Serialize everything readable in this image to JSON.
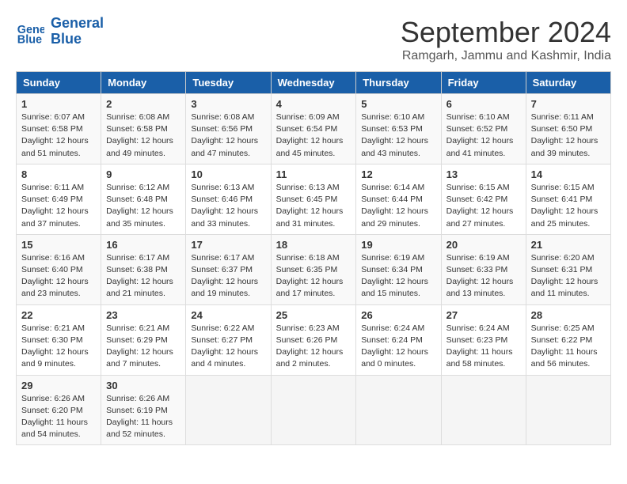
{
  "header": {
    "logo_line1": "General",
    "logo_line2": "Blue",
    "title": "September 2024",
    "location": "Ramgarh, Jammu and Kashmir, India"
  },
  "columns": [
    "Sunday",
    "Monday",
    "Tuesday",
    "Wednesday",
    "Thursday",
    "Friday",
    "Saturday"
  ],
  "weeks": [
    [
      {
        "day": "1",
        "sunrise": "Sunrise: 6:07 AM",
        "sunset": "Sunset: 6:58 PM",
        "daylight": "Daylight: 12 hours and 51 minutes."
      },
      {
        "day": "2",
        "sunrise": "Sunrise: 6:08 AM",
        "sunset": "Sunset: 6:58 PM",
        "daylight": "Daylight: 12 hours and 49 minutes."
      },
      {
        "day": "3",
        "sunrise": "Sunrise: 6:08 AM",
        "sunset": "Sunset: 6:56 PM",
        "daylight": "Daylight: 12 hours and 47 minutes."
      },
      {
        "day": "4",
        "sunrise": "Sunrise: 6:09 AM",
        "sunset": "Sunset: 6:54 PM",
        "daylight": "Daylight: 12 hours and 45 minutes."
      },
      {
        "day": "5",
        "sunrise": "Sunrise: 6:10 AM",
        "sunset": "Sunset: 6:53 PM",
        "daylight": "Daylight: 12 hours and 43 minutes."
      },
      {
        "day": "6",
        "sunrise": "Sunrise: 6:10 AM",
        "sunset": "Sunset: 6:52 PM",
        "daylight": "Daylight: 12 hours and 41 minutes."
      },
      {
        "day": "7",
        "sunrise": "Sunrise: 6:11 AM",
        "sunset": "Sunset: 6:50 PM",
        "daylight": "Daylight: 12 hours and 39 minutes."
      }
    ],
    [
      {
        "day": "8",
        "sunrise": "Sunrise: 6:11 AM",
        "sunset": "Sunset: 6:49 PM",
        "daylight": "Daylight: 12 hours and 37 minutes."
      },
      {
        "day": "9",
        "sunrise": "Sunrise: 6:12 AM",
        "sunset": "Sunset: 6:48 PM",
        "daylight": "Daylight: 12 hours and 35 minutes."
      },
      {
        "day": "10",
        "sunrise": "Sunrise: 6:13 AM",
        "sunset": "Sunset: 6:46 PM",
        "daylight": "Daylight: 12 hours and 33 minutes."
      },
      {
        "day": "11",
        "sunrise": "Sunrise: 6:13 AM",
        "sunset": "Sunset: 6:45 PM",
        "daylight": "Daylight: 12 hours and 31 minutes."
      },
      {
        "day": "12",
        "sunrise": "Sunrise: 6:14 AM",
        "sunset": "Sunset: 6:44 PM",
        "daylight": "Daylight: 12 hours and 29 minutes."
      },
      {
        "day": "13",
        "sunrise": "Sunrise: 6:15 AM",
        "sunset": "Sunset: 6:42 PM",
        "daylight": "Daylight: 12 hours and 27 minutes."
      },
      {
        "day": "14",
        "sunrise": "Sunrise: 6:15 AM",
        "sunset": "Sunset: 6:41 PM",
        "daylight": "Daylight: 12 hours and 25 minutes."
      }
    ],
    [
      {
        "day": "15",
        "sunrise": "Sunrise: 6:16 AM",
        "sunset": "Sunset: 6:40 PM",
        "daylight": "Daylight: 12 hours and 23 minutes."
      },
      {
        "day": "16",
        "sunrise": "Sunrise: 6:17 AM",
        "sunset": "Sunset: 6:38 PM",
        "daylight": "Daylight: 12 hours and 21 minutes."
      },
      {
        "day": "17",
        "sunrise": "Sunrise: 6:17 AM",
        "sunset": "Sunset: 6:37 PM",
        "daylight": "Daylight: 12 hours and 19 minutes."
      },
      {
        "day": "18",
        "sunrise": "Sunrise: 6:18 AM",
        "sunset": "Sunset: 6:35 PM",
        "daylight": "Daylight: 12 hours and 17 minutes."
      },
      {
        "day": "19",
        "sunrise": "Sunrise: 6:19 AM",
        "sunset": "Sunset: 6:34 PM",
        "daylight": "Daylight: 12 hours and 15 minutes."
      },
      {
        "day": "20",
        "sunrise": "Sunrise: 6:19 AM",
        "sunset": "Sunset: 6:33 PM",
        "daylight": "Daylight: 12 hours and 13 minutes."
      },
      {
        "day": "21",
        "sunrise": "Sunrise: 6:20 AM",
        "sunset": "Sunset: 6:31 PM",
        "daylight": "Daylight: 12 hours and 11 minutes."
      }
    ],
    [
      {
        "day": "22",
        "sunrise": "Sunrise: 6:21 AM",
        "sunset": "Sunset: 6:30 PM",
        "daylight": "Daylight: 12 hours and 9 minutes."
      },
      {
        "day": "23",
        "sunrise": "Sunrise: 6:21 AM",
        "sunset": "Sunset: 6:29 PM",
        "daylight": "Daylight: 12 hours and 7 minutes."
      },
      {
        "day": "24",
        "sunrise": "Sunrise: 6:22 AM",
        "sunset": "Sunset: 6:27 PM",
        "daylight": "Daylight: 12 hours and 4 minutes."
      },
      {
        "day": "25",
        "sunrise": "Sunrise: 6:23 AM",
        "sunset": "Sunset: 6:26 PM",
        "daylight": "Daylight: 12 hours and 2 minutes."
      },
      {
        "day": "26",
        "sunrise": "Sunrise: 6:24 AM",
        "sunset": "Sunset: 6:24 PM",
        "daylight": "Daylight: 12 hours and 0 minutes."
      },
      {
        "day": "27",
        "sunrise": "Sunrise: 6:24 AM",
        "sunset": "Sunset: 6:23 PM",
        "daylight": "Daylight: 11 hours and 58 minutes."
      },
      {
        "day": "28",
        "sunrise": "Sunrise: 6:25 AM",
        "sunset": "Sunset: 6:22 PM",
        "daylight": "Daylight: 11 hours and 56 minutes."
      }
    ],
    [
      {
        "day": "29",
        "sunrise": "Sunrise: 6:26 AM",
        "sunset": "Sunset: 6:20 PM",
        "daylight": "Daylight: 11 hours and 54 minutes."
      },
      {
        "day": "30",
        "sunrise": "Sunrise: 6:26 AM",
        "sunset": "Sunset: 6:19 PM",
        "daylight": "Daylight: 11 hours and 52 minutes."
      },
      null,
      null,
      null,
      null,
      null
    ]
  ]
}
